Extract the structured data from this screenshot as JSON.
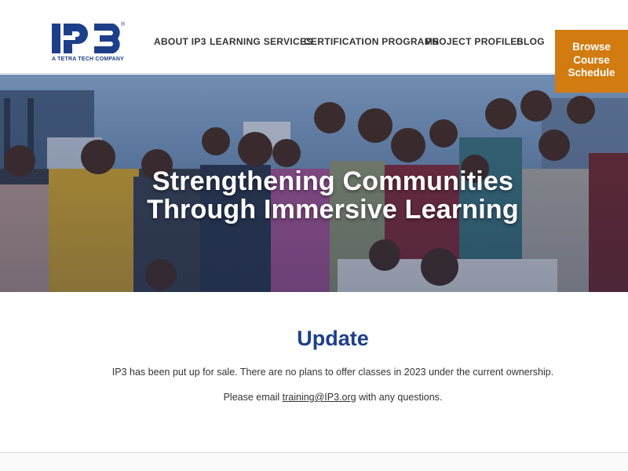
{
  "header": {
    "logo_text": "IP3",
    "logo_tagline": "A TETRA TECH COMPANY",
    "logo_registered": "®",
    "nav": [
      {
        "label": "ABOUT IP3"
      },
      {
        "label": "LEARNING SERVICES"
      },
      {
        "label": "CERTIFICATION PROGRAMS"
      },
      {
        "label": "PROJECT PROFILES"
      },
      {
        "label": "BLOG"
      }
    ],
    "cta": {
      "line1": "Browse",
      "line2": "Course",
      "line3": "Schedule"
    }
  },
  "hero": {
    "title_line1": "Strengthening Communities",
    "title_line2": "Through Immersive Learning"
  },
  "update": {
    "title": "Update",
    "text": "IP3 has been put up for sale. There are no plans to offer classes in 2023 under the current ownership.",
    "email_prefix": "Please email ",
    "email": "training@IP3.org",
    "email_suffix": " with any questions."
  },
  "colors": {
    "brand_blue": "#1d3f8a",
    "cta_orange": "#d17b10"
  }
}
